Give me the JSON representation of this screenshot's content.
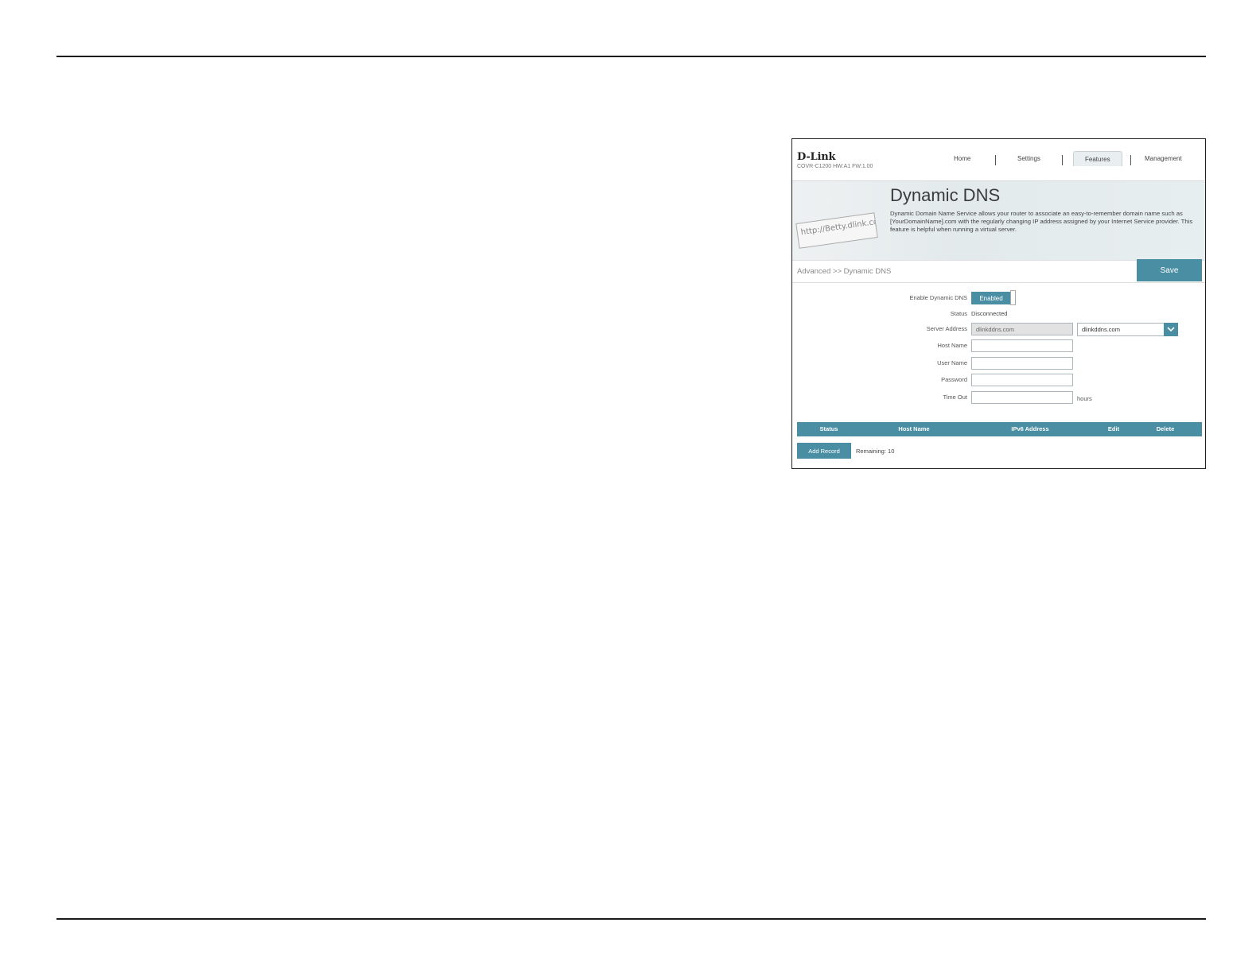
{
  "header": {
    "logo": "D-Link",
    "model": "COVR-C1200 HW:A1 FW:1.00",
    "nav": [
      "Home",
      "Settings",
      "Features",
      "Management"
    ],
    "active_nav": "Features"
  },
  "banner": {
    "art_text": "http://Betty.dlink.com",
    "title": "Dynamic DNS",
    "description": "Dynamic Domain Name Service allows your router to associate an easy-to-remember domain name such as [YourDomainName].com with the regularly changing IP address assigned by your Internet Service provider. This feature is helpful when running a virtual server."
  },
  "breadcrumb": "Advanced >> Dynamic DNS",
  "save_label": "Save",
  "form": {
    "enable_label": "Enable Dynamic DNS",
    "enable_value": "Enabled",
    "status_label": "Status",
    "status_value": "Disconnected",
    "server_label": "Server Address",
    "server_value": "dlinkddns.com",
    "server_select": "dlinkddns.com",
    "host_label": "Host Name",
    "host_value": "",
    "user_label": "User Name",
    "user_value": "",
    "password_label": "Password",
    "password_value": "",
    "timeout_label": "Time Out",
    "timeout_value": "",
    "timeout_unit": "hours"
  },
  "table": {
    "columns": [
      "Status",
      "Host Name",
      "IPv6 Address",
      "Edit",
      "Delete"
    ]
  },
  "add_record_label": "Add Record",
  "remaining": "Remaining: 10",
  "colors": {
    "accent": "#4a8ea3"
  }
}
